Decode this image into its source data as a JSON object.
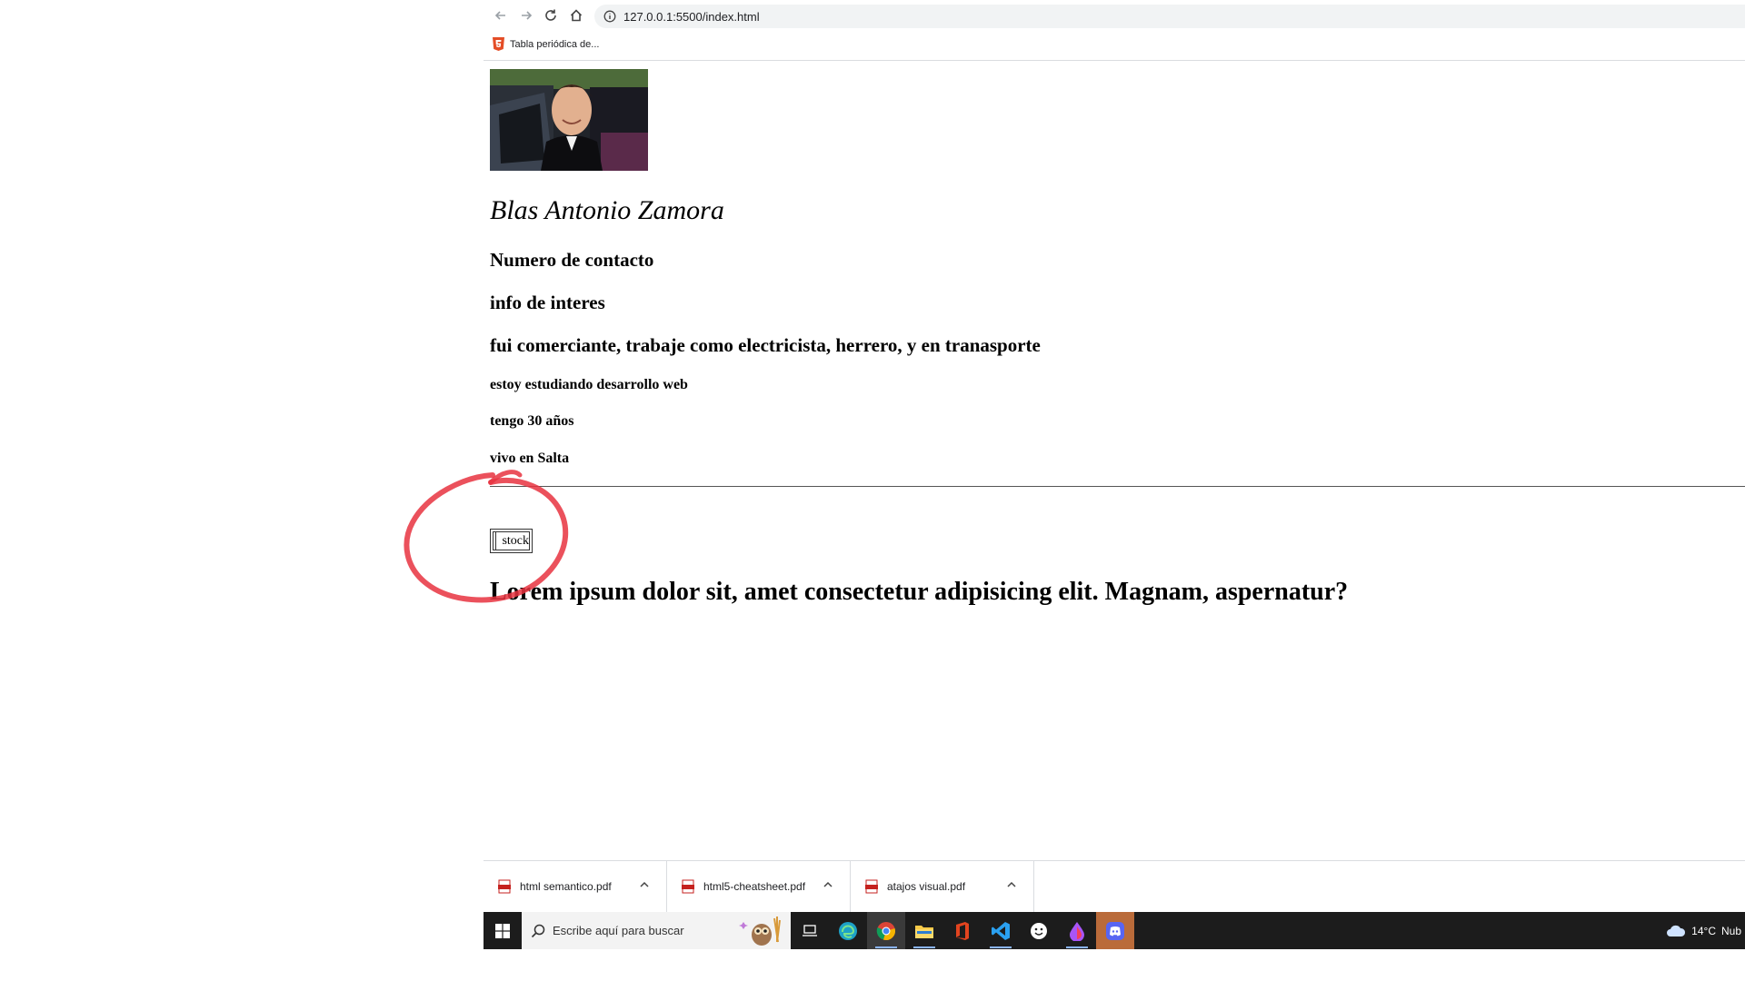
{
  "browser": {
    "url": "127.0.0.1:5500/index.html",
    "bookmark_label": "Tabla periódica de..."
  },
  "page": {
    "name": "Blas Antonio Zamora",
    "contact": "Numero de contacto",
    "info": "info de interes",
    "work": "fui comerciante, trabaje como electricista, herrero, y en tranasporte",
    "study": "estoy estudiando desarrollo web",
    "age": "tengo 30 años",
    "city": "vivo en Salta",
    "stock_label": "stock",
    "lorem": "Lorem ipsum dolor sit, amet consectetur adipisicing elit. Magnam, aspernatur?"
  },
  "downloads": [
    {
      "file": "html semantico.pdf"
    },
    {
      "file": "html5-cheatsheet.pdf"
    },
    {
      "file": "atajos visual.pdf"
    }
  ],
  "taskbar": {
    "search_placeholder": "Escribe aquí para buscar",
    "temperature": "14°C",
    "weather_text": "Nub"
  },
  "colors": {
    "annotation": "#e8333f",
    "taskbar": "#1c1c1c",
    "accent": "#8ab4f8"
  }
}
